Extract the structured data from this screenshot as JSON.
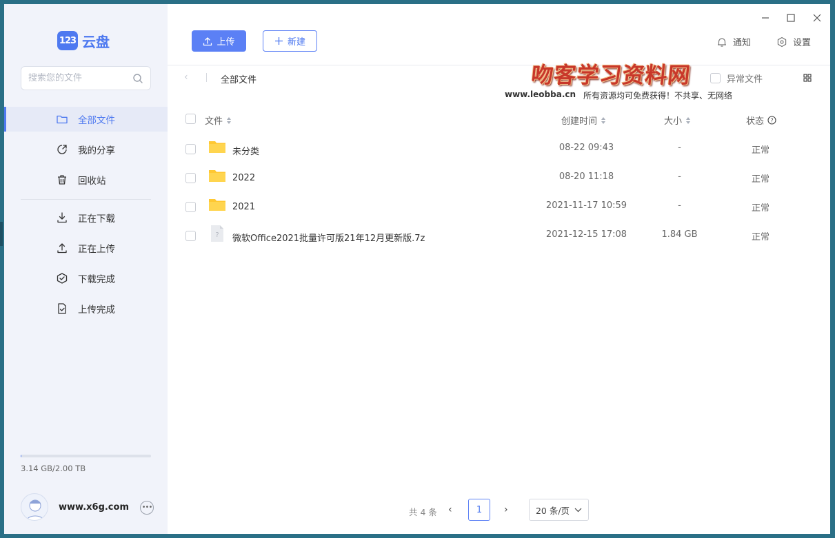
{
  "brand": {
    "badge": "123",
    "name": "云盘"
  },
  "search": {
    "placeholder": "搜索您的文件"
  },
  "sidebar": {
    "items": [
      {
        "label": "全部文件",
        "icon": "folder-icon",
        "active": true
      },
      {
        "label": "我的分享",
        "icon": "share-icon"
      },
      {
        "label": "回收站",
        "icon": "trash-icon"
      },
      {
        "label": "正在下载",
        "icon": "download-icon"
      },
      {
        "label": "正在上传",
        "icon": "upload-icon"
      },
      {
        "label": "下载完成",
        "icon": "check-circle-icon"
      },
      {
        "label": "上传完成",
        "icon": "file-check-icon"
      }
    ],
    "storage_text": "3.14 GB/2.00 TB",
    "storage_fraction": 0.0016,
    "username": "www.x6g.com"
  },
  "toolbar": {
    "upload_label": "上传",
    "new_label": "新建",
    "notify_label": "通知",
    "settings_label": "设置"
  },
  "breadcrumb": {
    "title": "全部文件"
  },
  "filter": {
    "abnormal_label": "异常文件"
  },
  "watermark": {
    "title": "吻客学习资料网",
    "url": "www.leobba.cn",
    "note": "所有资源均可免费获得！不共享、无网络"
  },
  "table": {
    "headers": {
      "name": "文件",
      "time": "创建时间",
      "size": "大小",
      "status": "状态"
    },
    "rows": [
      {
        "name": "未分类",
        "type": "folder",
        "time": "08-22 09:43",
        "size": "-",
        "status": "正常"
      },
      {
        "name": "2022",
        "type": "folder",
        "time": "08-20 11:18",
        "size": "-",
        "status": "正常"
      },
      {
        "name": "2021",
        "type": "folder",
        "time": "2021-11-17 10:59",
        "size": "-",
        "status": "正常"
      },
      {
        "name": "微软Office2021批量许可版21年12月更新版.7z",
        "type": "file",
        "time": "2021-12-15 17:08",
        "size": "1.84 GB",
        "status": "正常"
      }
    ]
  },
  "pagination": {
    "total": "共 4 条",
    "current": "1",
    "page_size": "20 条/页"
  },
  "colors": {
    "accent": "#4e79f0",
    "sidebar_bg": "#f1f3fa",
    "folder": "#ffc832"
  }
}
